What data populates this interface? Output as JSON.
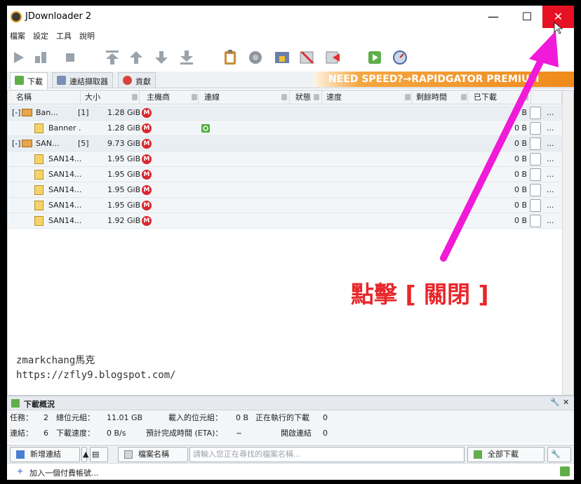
{
  "window": {
    "title": "JDownloader 2",
    "min": "—",
    "max": "☐",
    "close": "✕"
  },
  "menu": [
    "檔案",
    "設定",
    "工具",
    "說明"
  ],
  "tabs": {
    "downloads": "下載",
    "linkgrabber": "連結擷取器",
    "donate": "貢獻"
  },
  "promo": "NEED SPEED?→RAPIDGATOR PREMIUM",
  "columns": {
    "name": "名稱",
    "size": "大小",
    "host": "主機商",
    "connection": "連線",
    "status": "狀態",
    "speed": "速度",
    "remaining": "剩餘時間",
    "downloaded": "已下載"
  },
  "rows": [
    {
      "type": "package",
      "name": "Ban...",
      "count": "[1]",
      "size": "1.28 GiB",
      "loaded": "0 B",
      "more": "..."
    },
    {
      "type": "file",
      "name": "Banner .",
      "size": "1.28 GiB",
      "loaded": "0 B",
      "more": "..."
    },
    {
      "type": "package",
      "name": "SAN...",
      "count": "[5]",
      "size": "9.73 GiB",
      "loaded": "0 B",
      "more": "..."
    },
    {
      "type": "file",
      "name": "SAN14...",
      "size": "1.95 GiB",
      "loaded": "0 B",
      "more": "..."
    },
    {
      "type": "file",
      "name": "SAN14...",
      "size": "1.95 GiB",
      "loaded": "0 B",
      "more": "..."
    },
    {
      "type": "file",
      "name": "SAN14...",
      "size": "1.95 GiB",
      "loaded": "0 B",
      "more": "..."
    },
    {
      "type": "file",
      "name": "SAN14...",
      "size": "1.95 GiB",
      "loaded": "0 B",
      "more": "..."
    },
    {
      "type": "file",
      "name": "SAN14...",
      "size": "1.92 GiB",
      "loaded": "0 B",
      "more": "..."
    }
  ],
  "host_badge": "M",
  "expand_toggle": "[-]",
  "watermark": {
    "line1": "zmarkchang馬克",
    "line2": "https://zfly9.blogspot.com/"
  },
  "annotation": "點擊 [ 關閉 ]",
  "overview": {
    "title": "下載概況",
    "tasks_label": "任務：",
    "tasks_value": "2",
    "total_label": "總位元組：",
    "total_value": "11.01 GB",
    "loaded_label": "載入的位元組：",
    "loaded_value": "0 B",
    "running_label": "正在執行的下載",
    "running_value": "0",
    "links_label": "連結：",
    "links_value": "6",
    "speed_label": "下載速度：",
    "speed_value": "0 B/s",
    "eta_label": "預計完成時間 (ETA)：",
    "eta_value": "~",
    "open_label": "開啟連結",
    "open_value": "0"
  },
  "bottom": {
    "add_links": "新增連結",
    "filename": "檔案名稱",
    "search_placeholder": "請輸入您正在尋找的檔案名稱...",
    "download_all": "全部下載"
  },
  "status": {
    "add_account": "加入一個付費帳號..."
  },
  "colors": {
    "accent_red": "#e81123",
    "annotation": "#e8262b",
    "arrow": "#f01ad8",
    "promo": "#ef8a1a"
  }
}
